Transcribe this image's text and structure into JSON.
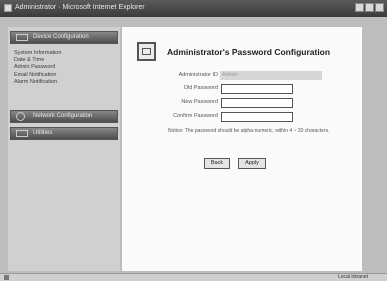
{
  "window": {
    "title": "Administrator · Microsoft Internet Explorer"
  },
  "sidebar": {
    "sections": [
      {
        "label": "Device Configuration",
        "icon": "device-config-icon"
      },
      {
        "label": "Network Configuration",
        "icon": "network-config-icon"
      },
      {
        "label": "Utilities",
        "icon": "utilities-icon"
      }
    ],
    "links": [
      "System Information",
      "Date & Time",
      "Admin Password",
      "Email Notification",
      "Alarm Notification"
    ]
  },
  "main": {
    "title": "Administrator's Password Configuration",
    "header_icon": "password-config-icon",
    "fields": {
      "user_label": "Administrator ID",
      "user_value": "Admin",
      "old_label": "Old Password",
      "new_label": "New Password",
      "confirm_label": "Confirm Password"
    },
    "hint": "Notice: The password should be alpha-numeric, within 4 ~ 20 characters.",
    "buttons": {
      "back": "Back",
      "apply": "Apply"
    }
  },
  "statusbar": {
    "zone": "Local intranet"
  }
}
